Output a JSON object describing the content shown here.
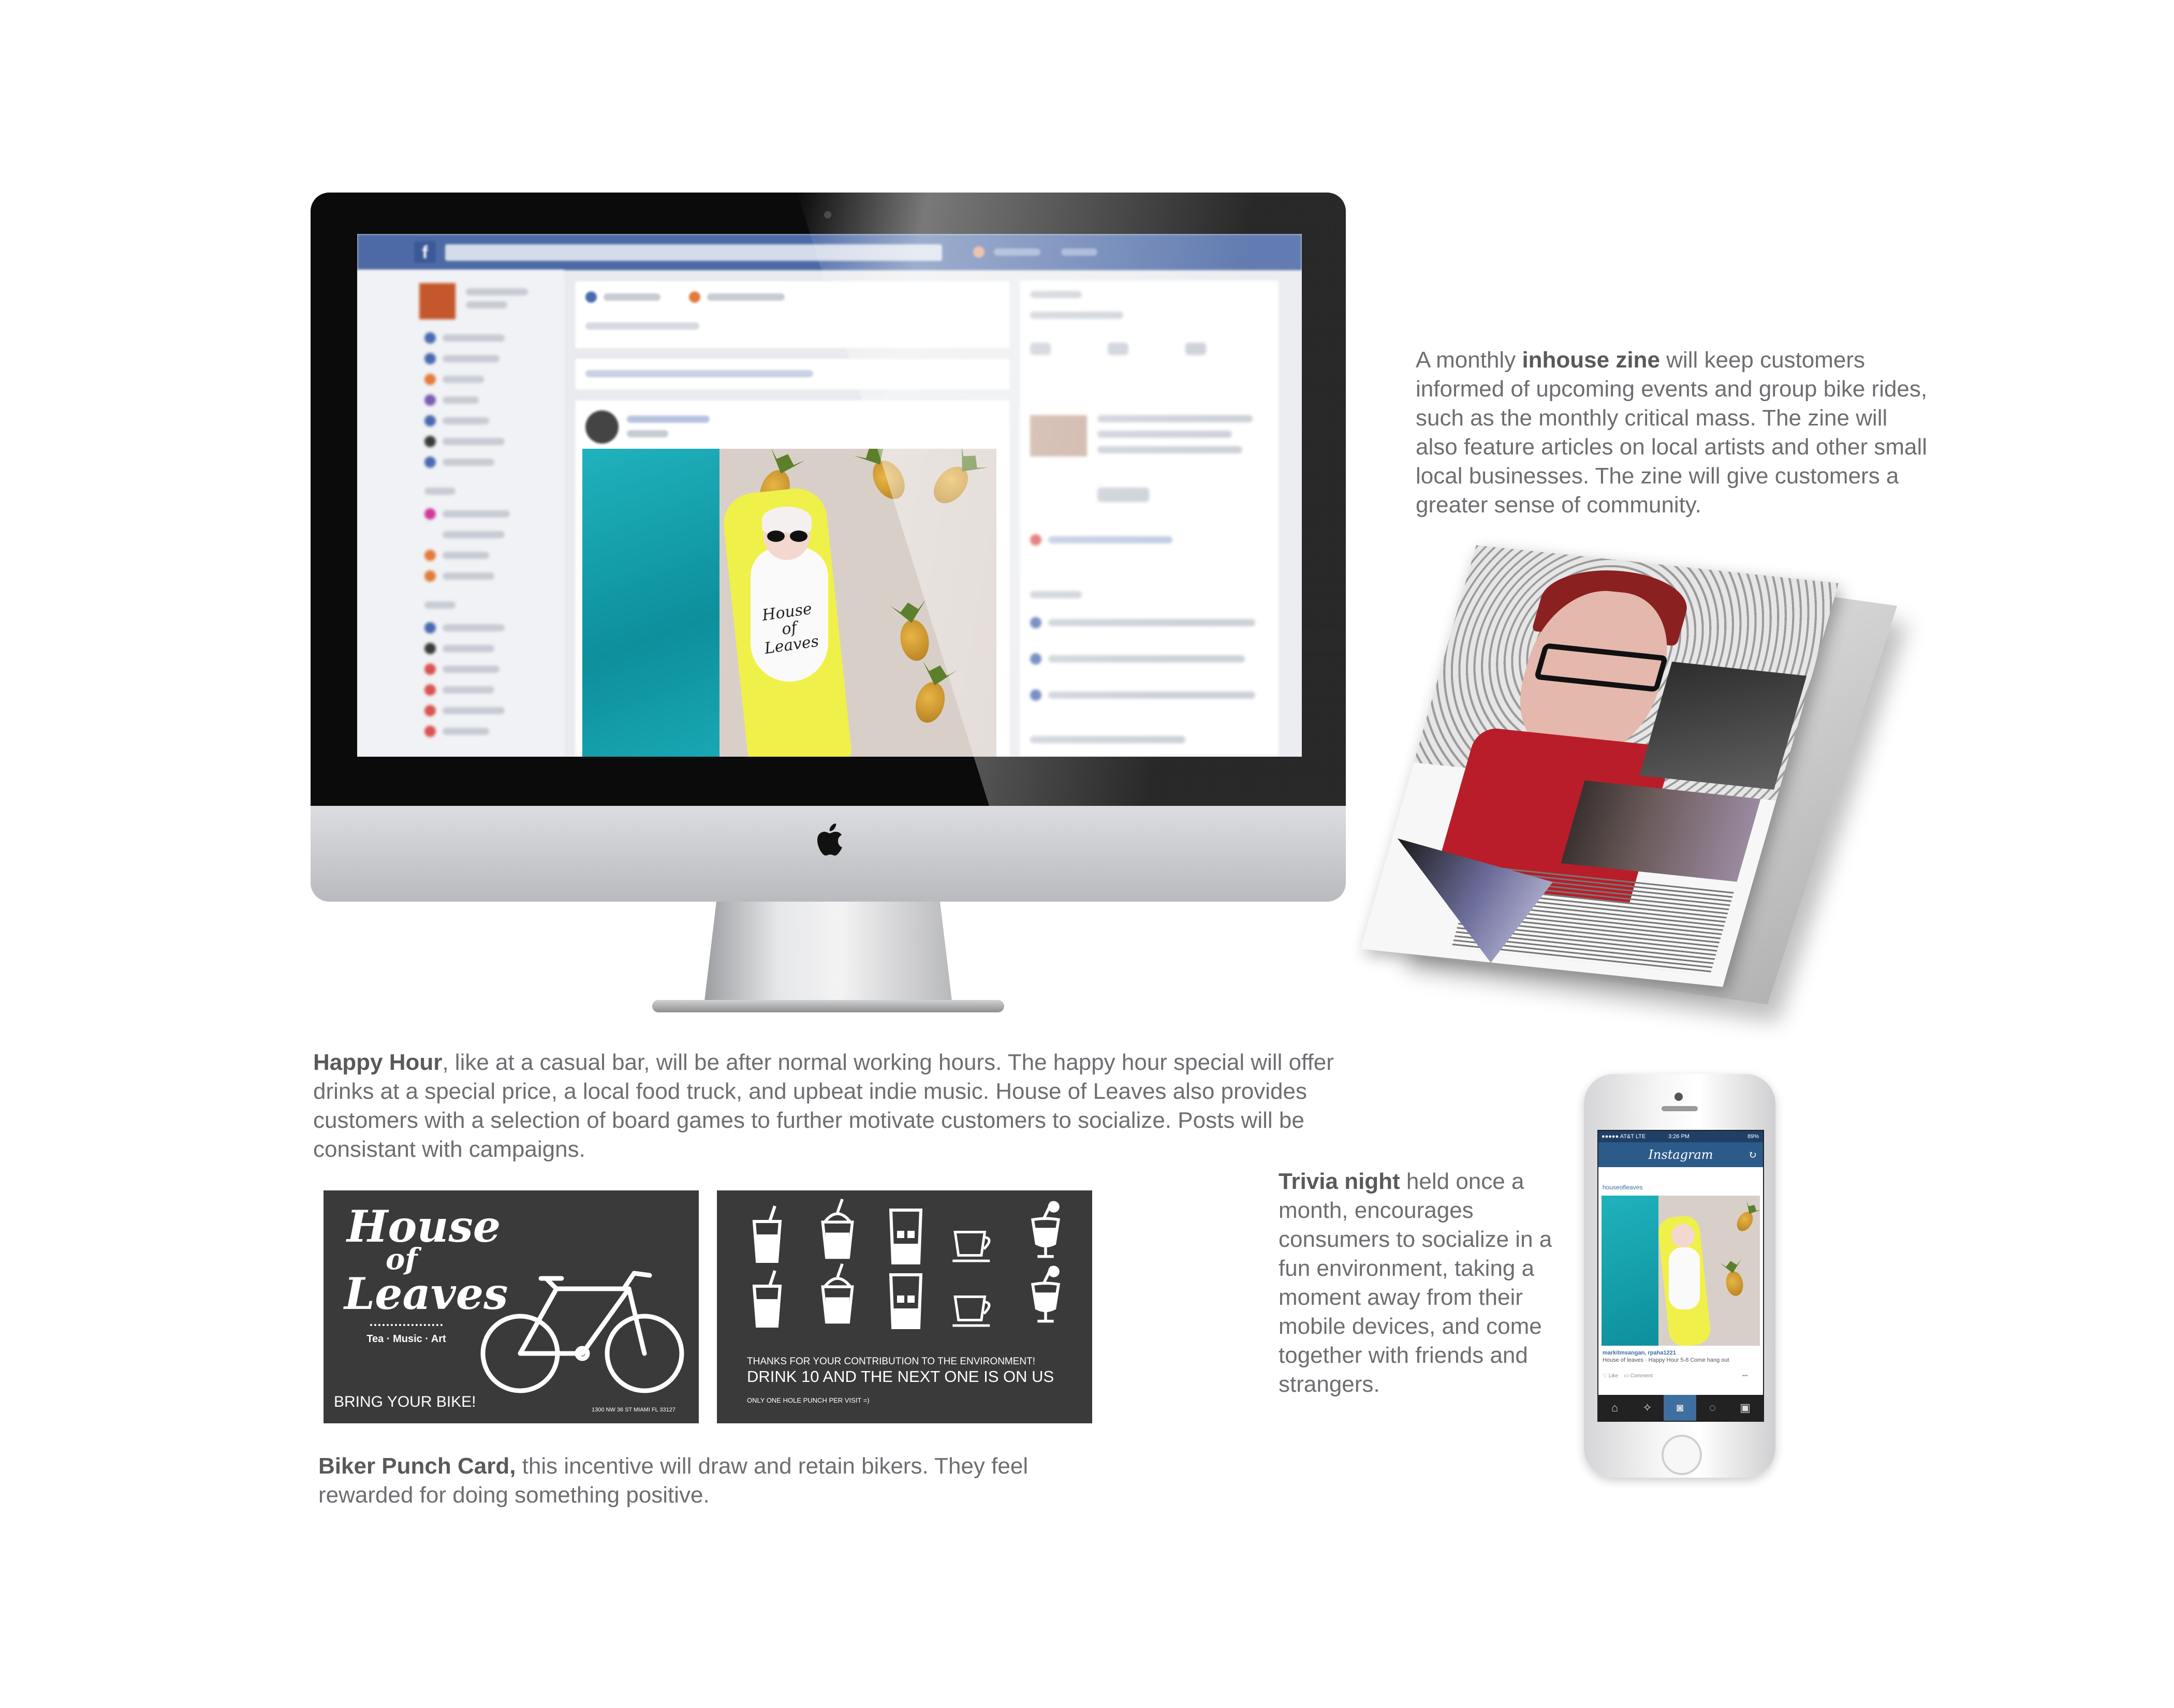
{
  "imac": {
    "screen_app": "facebook",
    "post_photo_shirt_text": "House of Leaves",
    "logo": "apple-icon"
  },
  "zine_text": {
    "p1": "A monthly ",
    "bold": "inhouse zine",
    "p2": " will keep customers informed of upcoming events and group bike rides, such as the monthly critical mass. The zine will also feature articles on local artists and other small local businesses. The zine will give customers a greater sense of community."
  },
  "happy_hour_text": {
    "bold": "Happy Hour",
    "rest": ", like at a casual bar, will be after normal working hours. The happy hour special will offer drinks at a special price, a local food truck, and upbeat indie music. House of Leaves also provides customers with a selection of board games to further motivate customers to socialize. Posts will be consistant with campaigns."
  },
  "trivia_text": {
    "bold": "Trivia night",
    "rest": " held once a month, encourages consumers to socialize in a fun environment, taking a moment away from their mobile devices, and come together with friends and strangers."
  },
  "biker_text": {
    "bold": "Biker Punch Card,",
    "rest": " this incentive will draw and retain bikers. They feel rewarded for doing something positive."
  },
  "card_front": {
    "title_line1": "House",
    "title_line2": "of",
    "title_line3": "Leaves",
    "tagline": "Tea · Music · Art",
    "cta": "BRING YOUR BIKE!",
    "address": "1300 NW 36 ST MIAMI FL 33127",
    "background": "#3a3a3a"
  },
  "card_back": {
    "thanks": "THANKS FOR YOUR CONTRIBUTION TO THE ENVIRONMENT!",
    "offer": "DRINK 10 AND THE NEXT ONE IS ON US",
    "rule": "ONLY ONE HOLE PUNCH PER VISIT =)"
  },
  "phone": {
    "carrier": "●●●●● AT&T LTE",
    "time": "3:26 PM",
    "battery": "89%",
    "app_title": "Instagram",
    "user": "houseofleaves",
    "caption_user": "markitmsangan, rpaha1221",
    "caption": "House of leaves · Happy Hour 5-8 Come hang out",
    "like": "Like",
    "comment": "Comment"
  },
  "colors": {
    "text_gray": "#6d6e71",
    "facebook_blue": "#4d6aa6",
    "instagram_blue": "#2c5b8a"
  }
}
